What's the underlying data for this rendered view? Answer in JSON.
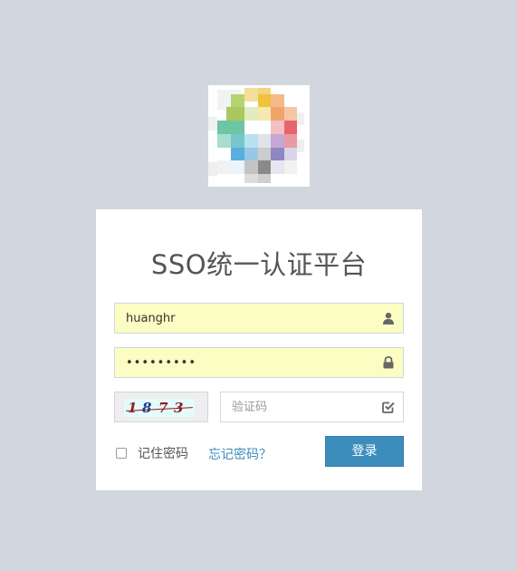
{
  "login": {
    "title": "SSO统一认证平台",
    "username": {
      "value": "huanghr"
    },
    "password": {
      "value": "•••••••••"
    },
    "captcha": {
      "image_digits": [
        "1",
        "8",
        "7",
        "3"
      ],
      "placeholder": "验证码"
    },
    "remember_label": "记住密码",
    "forgot_label": "忘记密码？",
    "submit_label": "登录"
  },
  "icons": {
    "username": "user-icon",
    "password": "lock-icon",
    "captcha": "check-square-icon"
  },
  "colors": {
    "page_background": "#d2d6de",
    "primary": "#3c8dbc",
    "autofill": "#fbfdc3",
    "captcha_text": "#8a1c1c"
  }
}
